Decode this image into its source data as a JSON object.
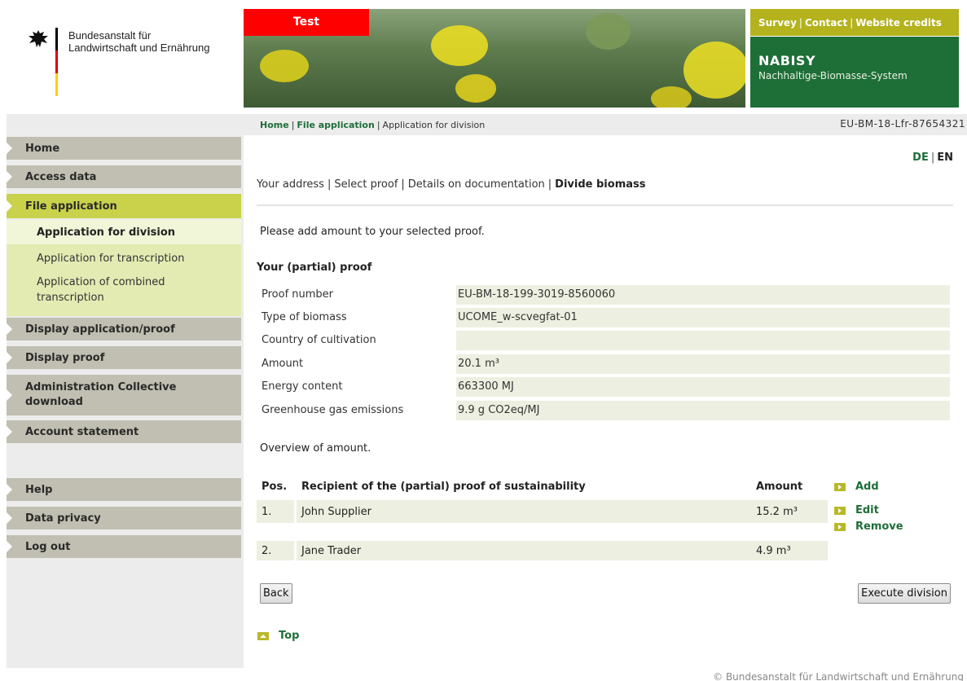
{
  "org": {
    "line1": "Bundesanstalt für",
    "line2": "Landwirtschaft und Ernährung"
  },
  "banner": {
    "badge": "Test"
  },
  "toplinks": {
    "survey": "Survey",
    "contact": "Contact",
    "credits": "Website credits"
  },
  "brand": {
    "title": "NABISY",
    "subtitle": "Nachhaltige-Biomasse-System"
  },
  "breadcrumb": {
    "home": "Home",
    "file_application": "File application",
    "current": "Application for division",
    "proof_id": "EU-BM-18-Lfr-87654321"
  },
  "sidebar": {
    "items": [
      {
        "label": "Home"
      },
      {
        "label": "Access data"
      },
      {
        "label": "File application"
      },
      {
        "label": "Display application/proof"
      },
      {
        "label": "Display proof"
      },
      {
        "label": "Administration Collective download"
      },
      {
        "label": "Account statement"
      },
      {
        "label": "Help"
      },
      {
        "label": "Data privacy"
      },
      {
        "label": "Log out"
      }
    ],
    "subitems": [
      {
        "label": "Application for division"
      },
      {
        "label": "Application for transcription"
      },
      {
        "label": "Application of combined transcription"
      }
    ]
  },
  "lang": {
    "de": "DE",
    "en": "EN"
  },
  "steps": {
    "address": "Your address",
    "select_proof": "Select proof",
    "details": "Details on documentation",
    "divide": "Divide biomass"
  },
  "intro": "Please add amount to your selected proof.",
  "proof": {
    "title": "Your (partial) proof",
    "rows": [
      {
        "label": "Proof number",
        "value": "EU-BM-18-199-3019-8560060"
      },
      {
        "label": "Type of biomass",
        "value": "UCOME_w-scvegfat-01"
      },
      {
        "label": "Country of cultivation",
        "value": ""
      },
      {
        "label": "Amount",
        "value": "20.1 m³"
      },
      {
        "label": "Energy content",
        "value": "663300 MJ"
      },
      {
        "label": "Greenhouse gas emissions",
        "value": "9.9 g CO2eq/MJ"
      }
    ]
  },
  "overview": "Overview of amount.",
  "table": {
    "headers": {
      "pos": "Pos.",
      "recipient": "Recipient of the (partial) proof of sustainability",
      "amount": "Amount"
    },
    "rows": [
      {
        "pos": "1.",
        "recipient": "John Supplier",
        "amount": "15.2 m³"
      },
      {
        "pos": "2.",
        "recipient": "Jane Trader",
        "amount": "4.9 m³"
      }
    ]
  },
  "actions": {
    "add": "Add",
    "edit": "Edit",
    "remove": "Remove"
  },
  "buttons": {
    "back": "Back",
    "execute": "Execute division"
  },
  "top_link": "Top",
  "footer": "© Bundesanstalt für Landwirtschaft und Ernährung",
  "colors": {
    "brand_green": "#1e6e38",
    "olive": "#b4b21d",
    "nav_active": "#c9d24a",
    "nav_default": "#c0bfb1",
    "test_red": "#ff0000"
  }
}
